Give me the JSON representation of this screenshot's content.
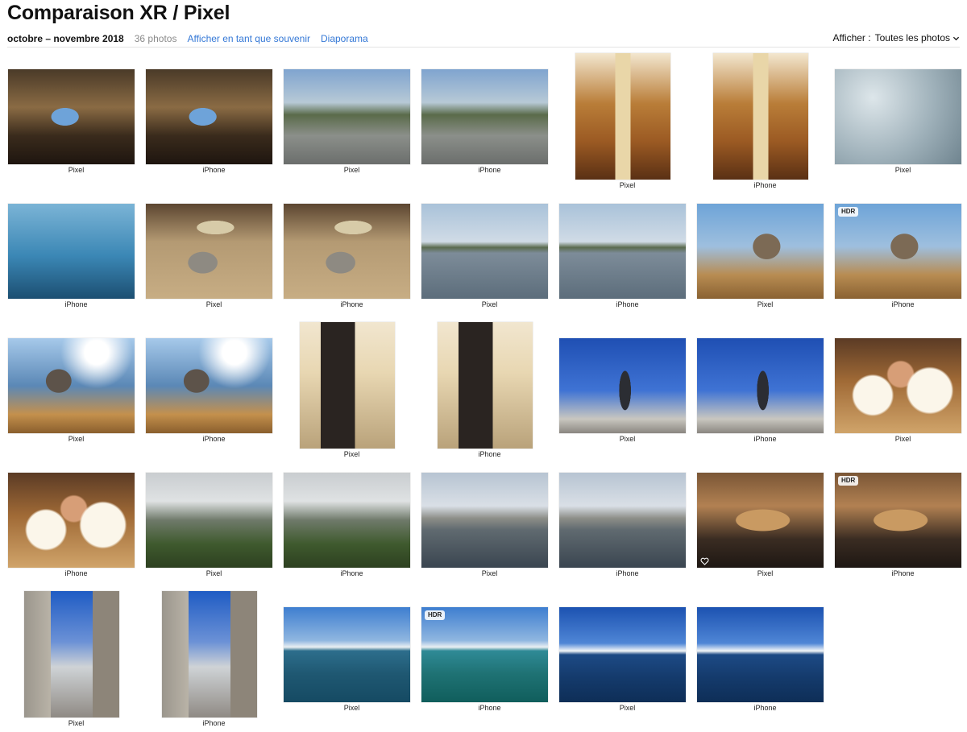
{
  "header": {
    "title": "Comparaison XR / Pixel",
    "date_range": "octobre – novembre 2018",
    "photo_count": "36 photos",
    "show_as_memory_link": "Afficher en tant que souvenir",
    "slideshow_link": "Diaporama",
    "filter_label": "Afficher :",
    "filter_value": "Toutes les photos"
  },
  "badges": {
    "hdr": "HDR"
  },
  "photos": [
    {
      "caption": "Pixel",
      "scene": "room"
    },
    {
      "caption": "iPhone",
      "scene": "room"
    },
    {
      "caption": "Pixel",
      "scene": "town"
    },
    {
      "caption": "iPhone",
      "scene": "town"
    },
    {
      "caption": "Pixel",
      "scene": "stairs"
    },
    {
      "caption": "iPhone",
      "scene": "stairs"
    },
    {
      "caption": "Pixel",
      "scene": "frost"
    },
    {
      "caption": "iPhone",
      "scene": "ice"
    },
    {
      "caption": "Pixel",
      "scene": "cat-rug"
    },
    {
      "caption": "iPhone",
      "scene": "cat-rug"
    },
    {
      "caption": "Pixel",
      "scene": "sea"
    },
    {
      "caption": "iPhone",
      "scene": "sea"
    },
    {
      "caption": "Pixel",
      "scene": "cat-roof"
    },
    {
      "caption": "iPhone",
      "scene": "cat-roof",
      "badge": "HDR"
    },
    {
      "caption": "Pixel",
      "scene": "cat-sky"
    },
    {
      "caption": "iPhone",
      "scene": "cat-sky"
    },
    {
      "caption": "Pixel",
      "scene": "cabinet"
    },
    {
      "caption": "iPhone",
      "scene": "cabinet"
    },
    {
      "caption": "Pixel",
      "scene": "statue"
    },
    {
      "caption": "iPhone",
      "scene": "statue"
    },
    {
      "caption": "Pixel",
      "scene": "dessert"
    },
    {
      "caption": "iPhone",
      "scene": "dessert"
    },
    {
      "caption": "Pixel",
      "scene": "forest"
    },
    {
      "caption": "iPhone",
      "scene": "forest"
    },
    {
      "caption": "Pixel",
      "scene": "canal"
    },
    {
      "caption": "iPhone",
      "scene": "canal"
    },
    {
      "caption": "Pixel",
      "scene": "tarts",
      "favorite": true
    },
    {
      "caption": "iPhone",
      "scene": "tarts",
      "badge": "HDR"
    },
    {
      "caption": "Pixel",
      "scene": "street"
    },
    {
      "caption": "iPhone",
      "scene": "street"
    },
    {
      "caption": "Pixel",
      "scene": "bay"
    },
    {
      "caption": "iPhone",
      "scene": "bay-green",
      "badge": "HDR"
    },
    {
      "caption": "Pixel",
      "scene": "island"
    },
    {
      "caption": "iPhone",
      "scene": "island"
    }
  ],
  "colors": {
    "link": "#3478d6",
    "muted": "#8a8a8a",
    "title": "#111111"
  }
}
